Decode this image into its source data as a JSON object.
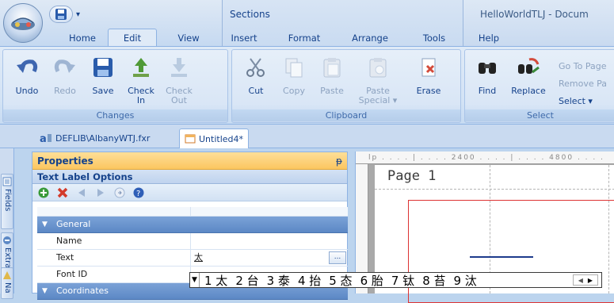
{
  "app": {
    "window_title": "HelloWorldTLJ - Docum",
    "context_tab_group": "Sections"
  },
  "tabs": [
    {
      "label": "Home"
    },
    {
      "label": "Edit",
      "active": true
    },
    {
      "label": "View"
    },
    {
      "label": "Insert"
    },
    {
      "label": "Format"
    },
    {
      "label": "Arrange"
    },
    {
      "label": "Tools"
    },
    {
      "label": "Help"
    }
  ],
  "ribbon": {
    "changes": {
      "label": "Changes",
      "buttons": [
        {
          "label": "Undo",
          "icon": "undo-icon"
        },
        {
          "label": "Redo",
          "icon": "redo-icon",
          "disabled": true
        },
        {
          "label": "Save",
          "icon": "save-icon"
        },
        {
          "label": "Check\nIn",
          "icon": "check-in-icon"
        },
        {
          "label": "Check\nOut",
          "icon": "check-out-icon",
          "disabled": true
        }
      ]
    },
    "clipboard": {
      "label": "Clipboard",
      "buttons": [
        {
          "label": "Cut",
          "icon": "cut-icon"
        },
        {
          "label": "Copy",
          "icon": "copy-icon",
          "disabled": true
        },
        {
          "label": "Paste",
          "icon": "paste-icon",
          "disabled": true
        },
        {
          "label": "Paste\nSpecial ▾",
          "icon": "paste-special-icon",
          "disabled": true
        },
        {
          "label": "Erase",
          "icon": "erase-icon"
        }
      ]
    },
    "select": {
      "label": "Select",
      "buttons": [
        {
          "label": "Find",
          "icon": "find-icon"
        },
        {
          "label": "Replace",
          "icon": "replace-icon"
        }
      ],
      "small": [
        {
          "label": "Go To Page",
          "disabled": true
        },
        {
          "label": "Remove Pa",
          "disabled": true
        },
        {
          "label": "Select ▾",
          "disabled": false
        }
      ]
    }
  },
  "doc_tabs": [
    {
      "label": "DEFLIB\\AlbanyWTJ.fxr",
      "icon": "report-file-icon"
    },
    {
      "label": "Untitled4*",
      "icon": "document-icon",
      "active": true
    }
  ],
  "side_tabs": [
    {
      "label": "Fields"
    },
    {
      "label": "Extract"
    },
    {
      "label": "Na"
    }
  ],
  "properties": {
    "title": "Properties",
    "pin": "ᵽ",
    "subtitle": "Text Label Options",
    "toolbar_icons": [
      "add-icon",
      "delete-icon",
      "previous-icon",
      "next-icon",
      "info-icon",
      "help-icon"
    ],
    "category": "General",
    "rows": [
      {
        "name": "Name",
        "value": ""
      },
      {
        "name": "Text",
        "value": "太"
      },
      {
        "name": "Font ID",
        "value": ""
      }
    ],
    "next_category": "Coordinates",
    "ellipsis": "..."
  },
  "ime": {
    "candidates": [
      "1 太",
      "2 台",
      "3 泰",
      "4 抬",
      "5 态",
      "6 胎",
      "7 钛",
      "8 苔",
      "9 汰"
    ]
  },
  "document": {
    "ruler_text": "lp  . . . . | . . . . 2400 . . . . | . . . . 4800 . . . .",
    "page_label": "Page 1"
  },
  "colors": {
    "ribbon_text": "#15428b",
    "panel_header": "#fbc660",
    "category_row": "#5c88c5",
    "page_border": "#dd3333"
  }
}
